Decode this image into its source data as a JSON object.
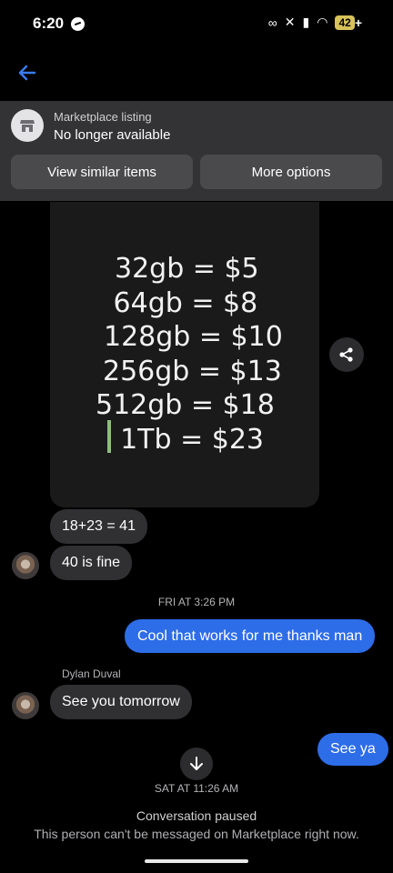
{
  "status_bar": {
    "time": "6:20",
    "battery": "42",
    "battery_suffix": "+"
  },
  "listing": {
    "kicker": "Marketplace listing",
    "status": "No longer available",
    "similar_button": "View similar items",
    "more_button": "More options"
  },
  "image_message": {
    "lines": [
      "32gb = $5",
      " 64gb = $8",
      "128gb = $10",
      "256gb = $13",
      "512gb = $18",
      "  1Tb = $23"
    ]
  },
  "messages": {
    "m1": "18+23 = 41",
    "m2": "40 is fine",
    "ts1": "FRI AT 3:26 PM",
    "m3": "Cool that works for me thanks man",
    "sender": "Dylan Duval",
    "m4": "See you tomorrow",
    "m5": "See ya",
    "ts2": "SAT AT 11:26 AM"
  },
  "footer": {
    "paused_title": "Conversation paused",
    "paused_desc": "This person can't be messaged on Marketplace right now."
  },
  "colors": {
    "accent": "#2d6de8",
    "back_arrow": "#3b7cf5",
    "incoming_bubble": "#303033",
    "banner": "#333335"
  }
}
